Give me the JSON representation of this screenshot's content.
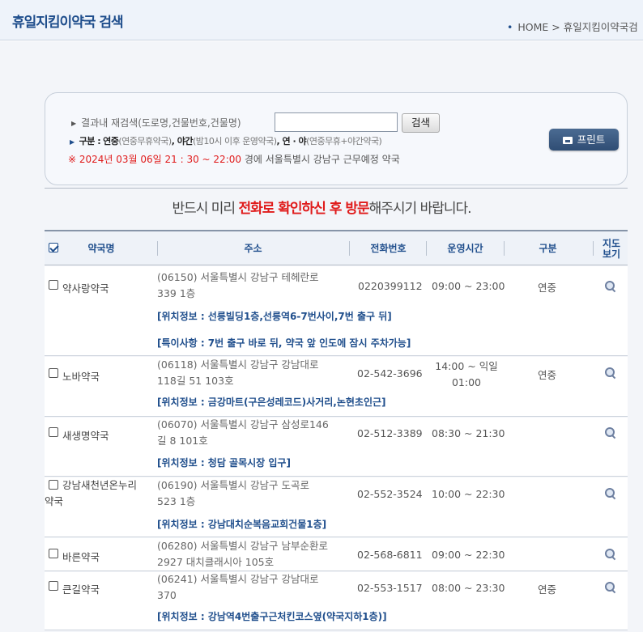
{
  "header": {
    "title": "휴일지킴이약국 검색",
    "breadcrumb_home": "HOME",
    "breadcrumb_sep": ">",
    "breadcrumb_current": "휴일지킴이약국검"
  },
  "search": {
    "label": "결과내 재검색(도로명,건물번호,건물명)",
    "value": "",
    "button_label": "검색",
    "legend_prefix": "구분 :",
    "legend_1_bold": "연중",
    "legend_1_desc": "(연중무휴약국)",
    "legend_2_bold": "야간",
    "legend_2_desc": "(밤10시 이후 운영약국)",
    "legend_3_bold": "연 · 야",
    "legend_3_desc": "(연중무휴+야간약국)",
    "date_mark": "※",
    "date_text": "2024년 03월 06일 21 : 30 ~ 22:00",
    "date_suffix": "경에  서울특별시  강남구   근무예정 약국",
    "print_label": "프린트"
  },
  "notice": {
    "pre": "반드시 미리 ",
    "highlight": "전화로 확인하신 후 방문",
    "post": "해주시기 바랍니다."
  },
  "table": {
    "headers": {
      "name": "약국명",
      "address": "주소",
      "phone": "전화번호",
      "hours": "운영시간",
      "type": "구분",
      "map_1": "지도",
      "map_2": "보기"
    },
    "rows": [
      {
        "name": "약사랑약국",
        "addr1": "(06150) 서울특별시 강남구 테헤란로",
        "addr2": "339 1층",
        "phone": "0220399112",
        "hours1": "09:00 ~ 23:00",
        "hours2": "",
        "type": "연중",
        "info1": "[위치정보 : 선릉빌딩1층,선릉역6-7번사이,7번 출구 뒤]",
        "info2": "[특이사항 : 7번 출구 바로 뒤, 약국 앞 인도에 잠시 주차가능]"
      },
      {
        "name": "노바약국",
        "addr1": "(06118) 서울특별시 강남구 강남대로",
        "addr2": "118길 51 103호",
        "phone": "02-542-3696",
        "hours1": "14:00 ~ 익일",
        "hours2": "01:00",
        "type": "연중",
        "info1": "[위치정보 : 금강마트(구은성레코드)사거리,논현초인근]",
        "info2": ""
      },
      {
        "name": "새생명약국",
        "addr1": "(06070) 서울특별시 강남구 삼성로146",
        "addr2": "길 8 101호",
        "phone": "02-512-3389",
        "hours1": "08:30 ~ 21:30",
        "hours2": "",
        "type": "",
        "info1": "[위치정보 : 청담 골목시장 입구]",
        "info2": ""
      },
      {
        "name": "강남새천년온누리",
        "name2": "약국",
        "addr1": "(06190) 서울특별시 강남구 도곡로",
        "addr2": "523 1층",
        "phone": "02-552-3524",
        "hours1": "10:00 ~ 22:30",
        "hours2": "",
        "type": "",
        "info1": "[위치정보 : 강남대치순복음교회건물1층]",
        "info2": ""
      },
      {
        "name": "바른약국",
        "addr1": "(06280) 서울특별시 강남구 남부순환로",
        "addr2": "2927 대치클래시아 105호",
        "phone": "02-568-6811",
        "hours1": "09:00 ~ 22:30",
        "hours2": "",
        "type": "",
        "info1": "",
        "info2": ""
      },
      {
        "name": "큰길약국",
        "addr1": "(06241) 서울특별시 강남구 강남대로",
        "addr2": "370",
        "phone": "02-553-1517",
        "hours1": "08:00 ~ 23:30",
        "hours2": "",
        "type": "연중",
        "info1": "[위치정보 : 강남역4번출구근처킨코스옆(약국지하1층)]",
        "info2": ""
      }
    ]
  },
  "colors": {
    "title_blue": "#1f4e8c",
    "alert_red": "#e01b1b",
    "print_button": "#3a5880"
  }
}
